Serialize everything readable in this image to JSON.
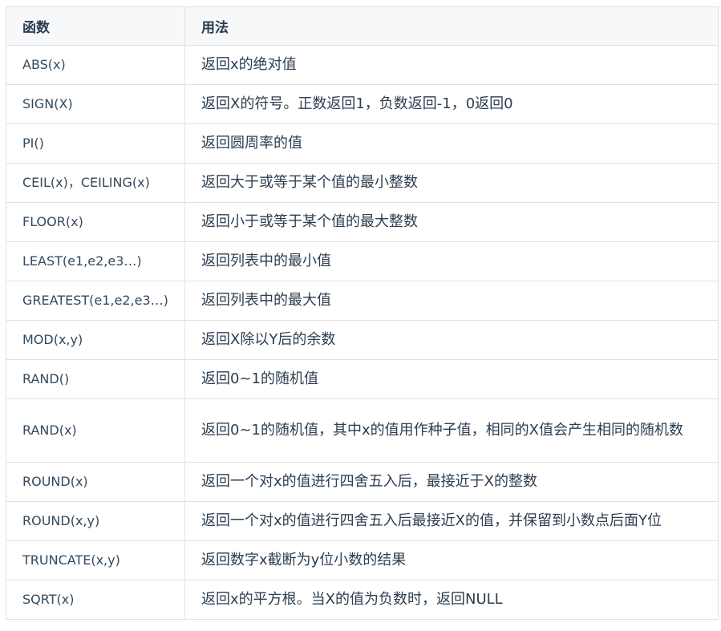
{
  "table": {
    "headers": [
      "函数",
      "用法"
    ],
    "rows": [
      {
        "fn": "ABS(x)",
        "desc": "返回x的绝对值"
      },
      {
        "fn": "SIGN(X)",
        "desc": "返回X的符号。正数返回1，负数返回-1，0返回0"
      },
      {
        "fn": "PI()",
        "desc": "返回圆周率的值"
      },
      {
        "fn": "CEIL(x)，CEILING(x)",
        "desc": "返回大于或等于某个值的最小整数"
      },
      {
        "fn": "FLOOR(x)",
        "desc": "返回小于或等于某个值的最大整数"
      },
      {
        "fn": "LEAST(e1,e2,e3…)",
        "desc": "返回列表中的最小值"
      },
      {
        "fn": "GREATEST(e1,e2,e3…)",
        "desc": "返回列表中的最大值"
      },
      {
        "fn": "MOD(x,y)",
        "desc": "返回X除以Y后的余数"
      },
      {
        "fn": "RAND()",
        "desc": "返回0~1的随机值"
      },
      {
        "fn": "RAND(x)",
        "desc": "返回0~1的随机值，其中x的值用作种子值，相同的X值会产生相同的随机数"
      },
      {
        "fn": "ROUND(x)",
        "desc": "返回一个对x的值进行四舍五入后，最接近于X的整数"
      },
      {
        "fn": "ROUND(x,y)",
        "desc": "返回一个对x的值进行四舍五入后最接近X的值，并保留到小数点后面Y位"
      },
      {
        "fn": "TRUNCATE(x,y)",
        "desc": "返回数字x截断为y位小数的结果"
      },
      {
        "fn": "SQRT(x)",
        "desc": "返回x的平方根。当X的值为负数时，返回NULL"
      }
    ]
  }
}
